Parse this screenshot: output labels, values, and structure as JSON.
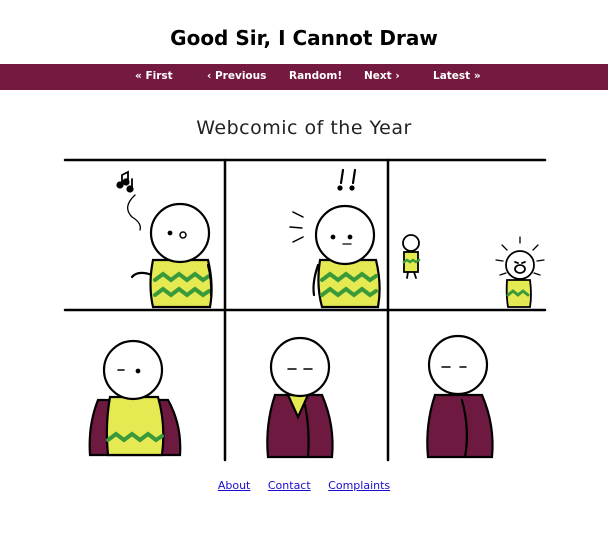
{
  "site": {
    "title": "Good Sir, I Cannot Draw"
  },
  "nav": {
    "first": "« First",
    "previous": "‹ Previous",
    "random": "Random!",
    "next": "Next ›",
    "latest": "Latest »"
  },
  "comic": {
    "title": "Webcomic of the Year"
  },
  "footer": {
    "about": "About",
    "contact": "Contact",
    "complaints": "Complaints"
  },
  "colors": {
    "nav_bg": "#74193f",
    "shirt": "#e6ea52",
    "zigzag": "#3a9a3a",
    "cloak": "#6e1a40"
  }
}
